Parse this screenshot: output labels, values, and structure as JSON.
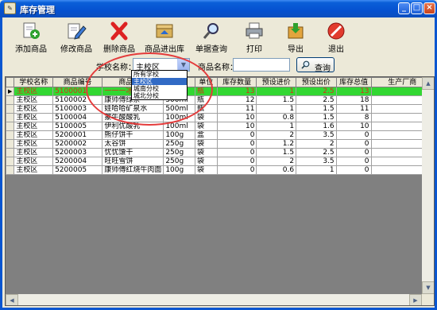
{
  "window": {
    "title": "库存管理",
    "icon": "app-icon"
  },
  "toolbar": [
    {
      "label": "添加商品",
      "icon": "add-icon"
    },
    {
      "label": "修改商品",
      "icon": "edit-icon"
    },
    {
      "label": "删除商品",
      "icon": "delete-icon"
    },
    {
      "label": "商品进出库",
      "icon": "in-out-icon"
    },
    {
      "label": "单据查询",
      "icon": "search-icon"
    },
    {
      "label": "打印",
      "icon": "printer-icon"
    },
    {
      "label": "导出",
      "icon": "export-icon"
    },
    {
      "label": "退出",
      "icon": "exit-icon"
    }
  ],
  "search": {
    "school_label": "学校名称：",
    "school_value": "主校区",
    "name_label": "商品名称：",
    "name_value": "",
    "query_label": "查询"
  },
  "dropdown": {
    "options": [
      "所有学校",
      "主校区",
      "城南分校",
      "城北分校"
    ],
    "selected_index": 1
  },
  "grid": {
    "columns": [
      "学校名称",
      "商品编号",
      "商品名称",
      "规格",
      "单位",
      "库存数量",
      "预设进价",
      "预设出价",
      "库存总值",
      "生产厂商"
    ],
    "rows": [
      [
        "主校区",
        "5100001",
        "一一一冰红茶",
        "500ml",
        "瓶",
        "13",
        "1",
        "2.5",
        "13",
        ""
      ],
      [
        "主校区",
        "5100002",
        "康师傅绿茶",
        "500ml",
        "瓶",
        "12",
        "1.5",
        "2.5",
        "18",
        ""
      ],
      [
        "主校区",
        "5100003",
        "娃哈哈矿泉水",
        "500ml",
        "瓶",
        "11",
        "1",
        "1.5",
        "11",
        ""
      ],
      [
        "主校区",
        "5100004",
        "蒙牛酸酸乳",
        "100ml",
        "袋",
        "10",
        "0.8",
        "1.5",
        "8",
        ""
      ],
      [
        "主校区",
        "5100005",
        "伊利优酸乳",
        "100ml",
        "袋",
        "10",
        "1",
        "1.6",
        "10",
        ""
      ],
      [
        "主校区",
        "5200001",
        "熊仔饼干",
        "100g",
        "盒",
        "0",
        "2",
        "3.5",
        "0",
        ""
      ],
      [
        "主校区",
        "5200002",
        "太谷饼",
        "250g",
        "袋",
        "0",
        "1.2",
        "2",
        "0",
        ""
      ],
      [
        "主校区",
        "5200003",
        "忧忧馕干",
        "250g",
        "袋",
        "0",
        "1.5",
        "2.5",
        "0",
        ""
      ],
      [
        "主校区",
        "5200004",
        "旺旺雪饼",
        "250g",
        "袋",
        "0",
        "2",
        "3.5",
        "0",
        ""
      ],
      [
        "主校区",
        "5200005",
        "康师傅红烧牛肉面",
        "100g",
        "袋",
        "0",
        "0.6",
        "1",
        "0",
        ""
      ]
    ],
    "selected_row": 0
  },
  "colors": {
    "selected_row_bg": "#32d732",
    "selected_row_text": "#d53018",
    "callout": "#e43b3b"
  }
}
